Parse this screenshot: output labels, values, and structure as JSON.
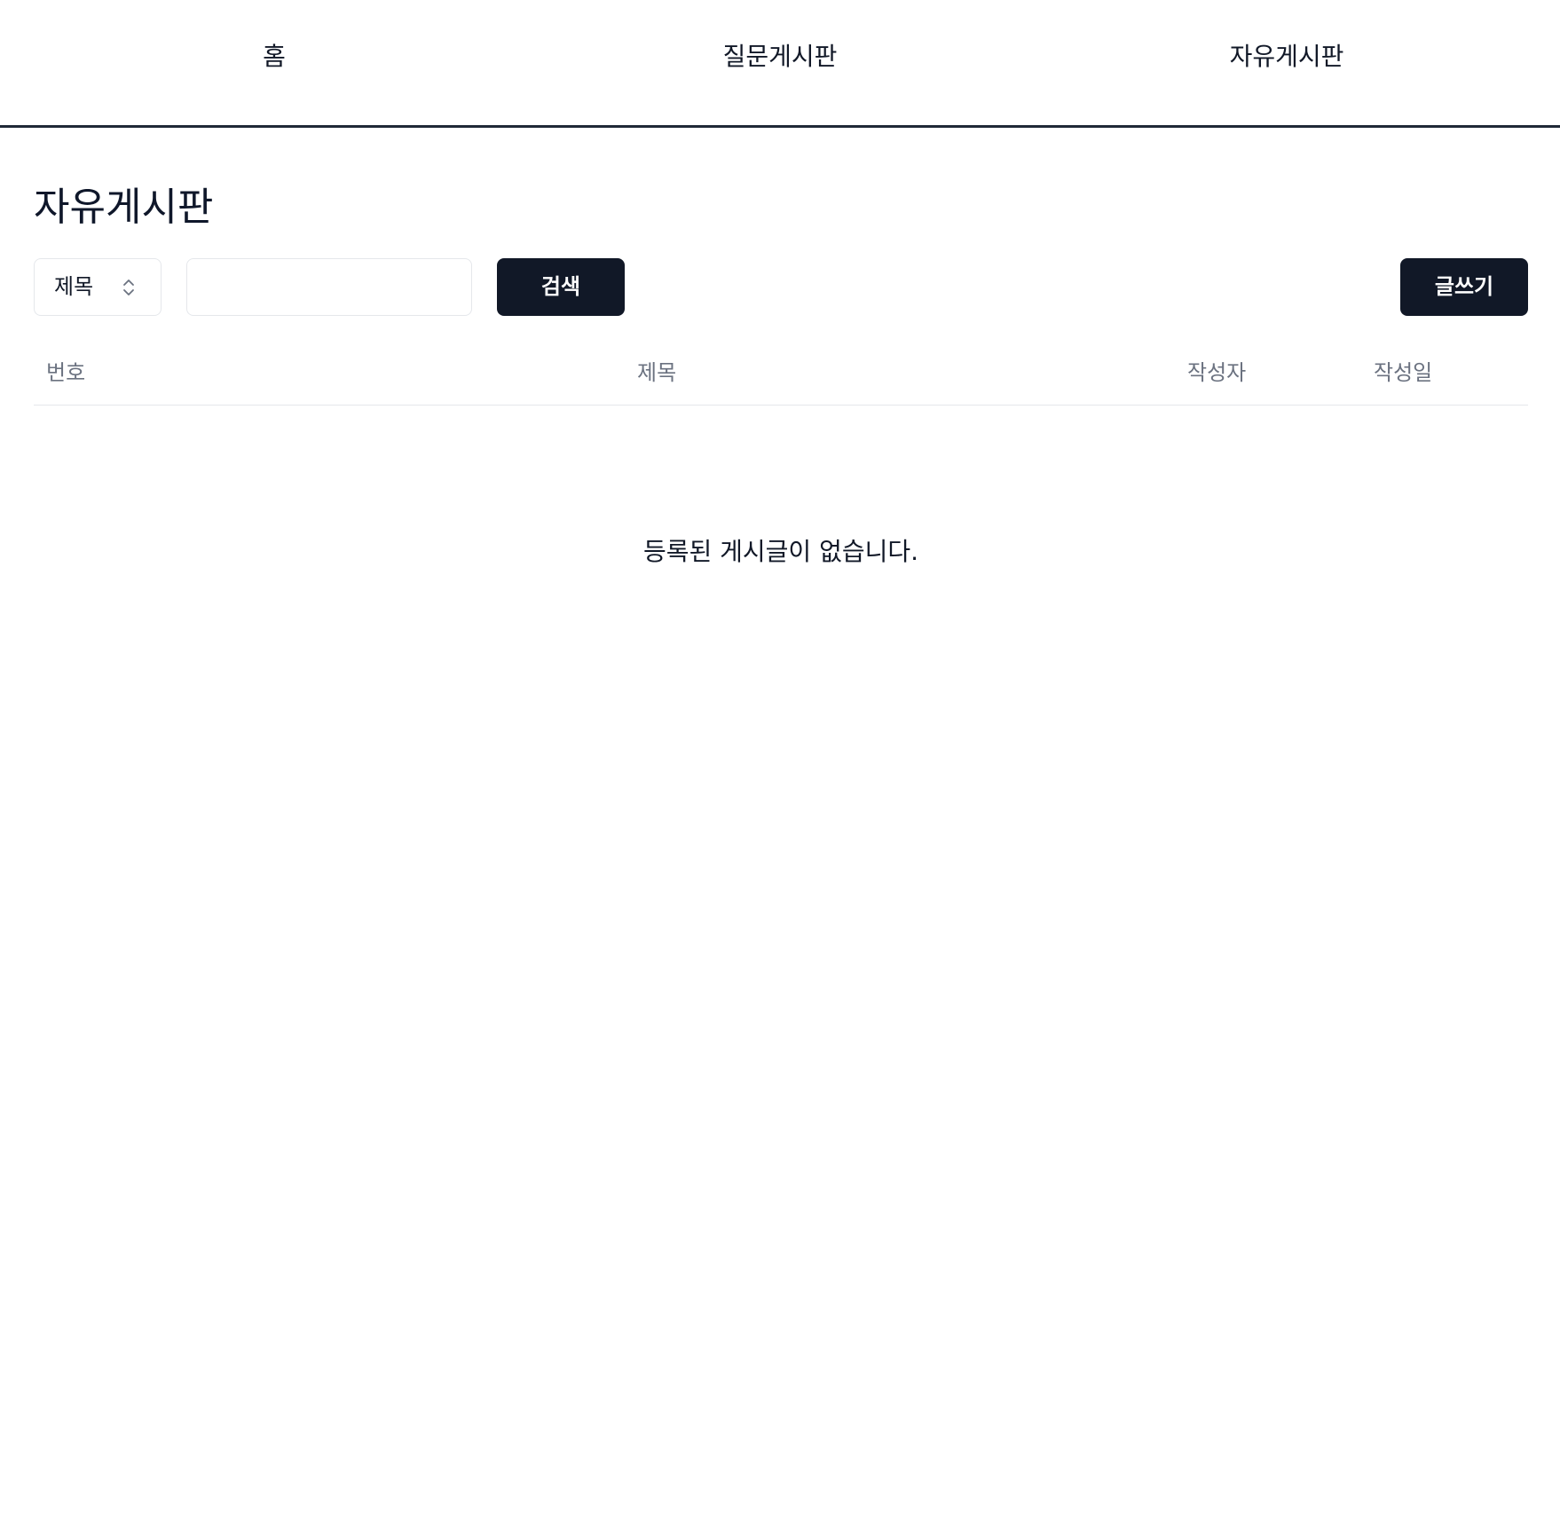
{
  "nav": {
    "items": [
      {
        "label": "홈"
      },
      {
        "label": "질문게시판"
      },
      {
        "label": "자유게시판"
      }
    ]
  },
  "page": {
    "title": "자유게시판"
  },
  "search": {
    "field_select": {
      "selected": "제목"
    },
    "query": {
      "value": "",
      "placeholder": ""
    },
    "search_button_label": "검색"
  },
  "write_button_label": "글쓰기",
  "table": {
    "columns": [
      "번호",
      "제목",
      "작성자",
      "작성일"
    ],
    "rows": [],
    "empty_message": "등록된 게시글이 없습니다."
  },
  "colors": {
    "primary_dark": "#111827",
    "header_text_muted": "#6b7280",
    "border": "#e5e7eb"
  }
}
